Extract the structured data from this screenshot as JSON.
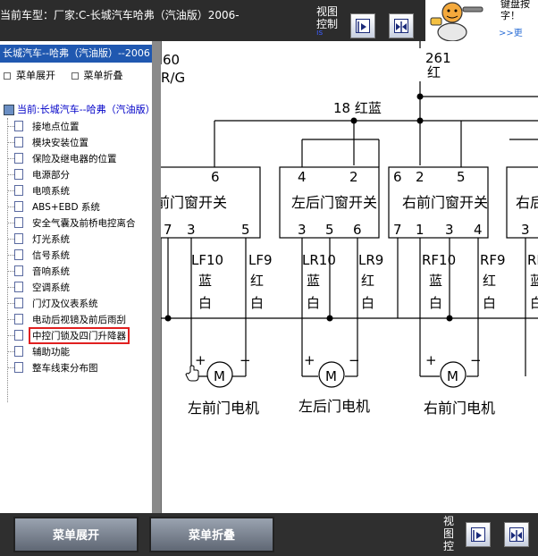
{
  "header": {
    "car_model": "当前车型：厂家:C-长城汽车哈弗（汽油版）2006-",
    "view_label": "视图控制",
    "view_sub": "is"
  },
  "promo": {
    "text": "键盘按\n字！",
    "more": ">>更"
  },
  "sidebar": {
    "header": "长城汽车--哈弗（汽油版）--2006",
    "expand_label": "菜单展开",
    "collapse_label": "菜单折叠",
    "root_label": "当前:长城汽车--哈弗（汽油版）",
    "items": [
      {
        "label": "接地点位置"
      },
      {
        "label": "模块安装位置"
      },
      {
        "label": "保险及继电器的位置"
      },
      {
        "label": "电源部分"
      },
      {
        "label": "电喷系统"
      },
      {
        "label": "ABS+EBD 系统"
      },
      {
        "label": "安全气囊及前桥电控离合"
      },
      {
        "label": "灯光系统"
      },
      {
        "label": "信号系统"
      },
      {
        "label": "音响系统"
      },
      {
        "label": "空调系统"
      },
      {
        "label": "门灯及仪表系统"
      },
      {
        "label": "电动后视镜及前后雨刮"
      },
      {
        "label": "中控门锁及四门升降器"
      },
      {
        "label": "辅助功能"
      },
      {
        "label": "整车线束分布图"
      }
    ],
    "selected_index": 13
  },
  "diagram": {
    "wire_top_left": "60",
    "wire_top_left2": "R/G",
    "wire_261": "261",
    "wire_261_color": "红",
    "wire_18": "18 红蓝",
    "switches": [
      {
        "label": "前门窗开关",
        "top_pin": "6",
        "pins": [
          "7",
          "3",
          "5"
        ]
      },
      {
        "label": "左后门窗开关",
        "top_pins": [
          "4",
          "2"
        ],
        "pins": [
          "3",
          "5",
          "6"
        ]
      },
      {
        "label": "右前门窗开关",
        "top_pins": [
          "6",
          "2",
          "5"
        ],
        "pins": [
          "7",
          "1",
          "3",
          "4"
        ]
      },
      {
        "label": "右后",
        "pins": [
          "3"
        ]
      }
    ],
    "wires": [
      {
        "code": "LF10",
        "c1": "蓝",
        "c2": "白"
      },
      {
        "code": "LF9",
        "c1": "红",
        "c2": "白"
      },
      {
        "code": "LR10",
        "c1": "蓝",
        "c2": "白"
      },
      {
        "code": "LR9",
        "c1": "红",
        "c2": "白"
      },
      {
        "code": "RF10",
        "c1": "蓝",
        "c2": "白"
      },
      {
        "code": "RF9",
        "c1": "红",
        "c2": "白"
      },
      {
        "code": "RR",
        "c1": "蓝",
        "c2": "白"
      }
    ],
    "motors": [
      {
        "label": "左前门电机"
      },
      {
        "label": "左后门电机"
      },
      {
        "label": "右前门电机"
      }
    ],
    "motor_symbol": "M",
    "plus": "+",
    "minus": "−"
  },
  "footer": {
    "expand_label": "菜单展开",
    "collapse_label": "菜单折叠",
    "view_label": "视图控"
  },
  "colors": {
    "sidebar_header": "#2058b0",
    "selected_outline": "#e02020",
    "toolbar_bg": "#2c2c2c"
  }
}
